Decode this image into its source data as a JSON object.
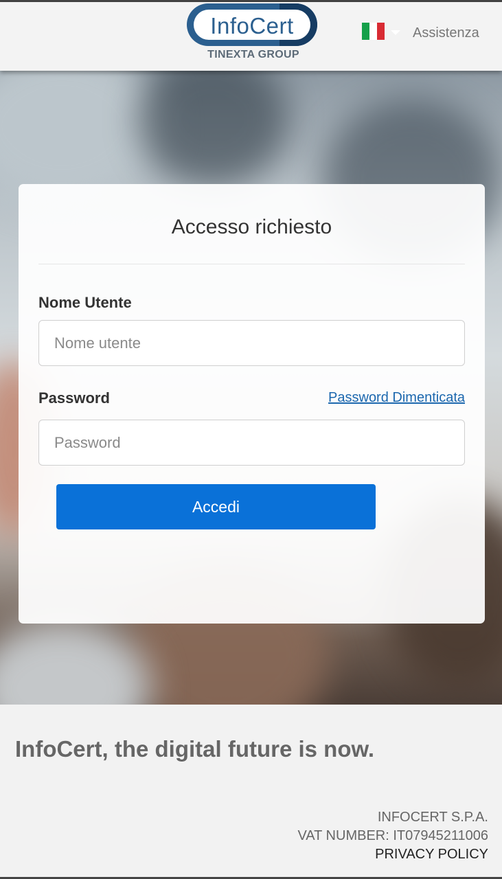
{
  "header": {
    "logo_text": "InfoCert",
    "logo_sub": "TINEXTA GROUP",
    "language_flag": "italy-flag-icon",
    "assist_label": "Assistenza"
  },
  "login": {
    "title": "Accesso richiesto",
    "username_label": "Nome Utente",
    "username_placeholder": "Nome utente",
    "username_value": "",
    "password_label": "Password",
    "password_placeholder": "Password",
    "password_value": "",
    "forgot_label": "Password Dimenticata",
    "submit_label": "Accedi"
  },
  "footer": {
    "tagline": "InfoCert, the digital future is now.",
    "company": "INFOCERT S.P.A.",
    "vat": "VAT NUMBER: IT07945211006",
    "privacy": "PRIVACY POLICY"
  },
  "colors": {
    "accent": "#0a71d8",
    "link": "#1b67ae",
    "brand": "#2b5f8f"
  }
}
